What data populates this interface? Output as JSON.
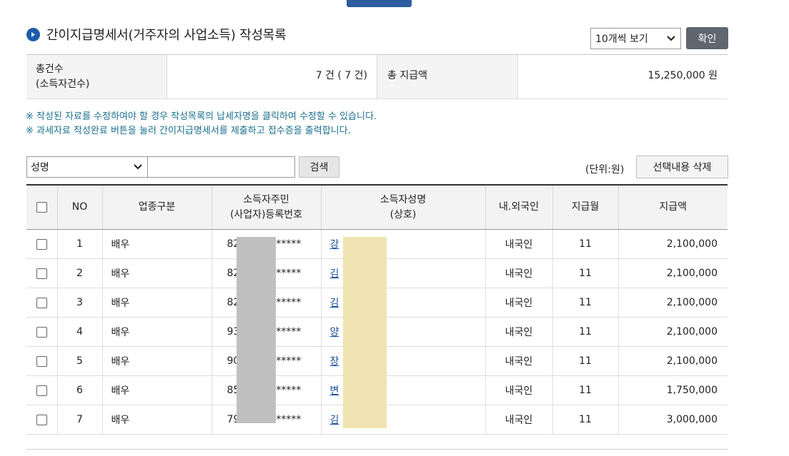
{
  "title": "간이지급명세서(거주자의 사업소득) 작성목록",
  "per_page": {
    "selected": "10개씩 보기"
  },
  "confirm_button": "확인",
  "summary": {
    "total_count_label_line1": "총건수",
    "total_count_label_line2": "(소득자건수)",
    "total_count_value": "7 건 ( 7 건)",
    "total_amount_label": "총 지급액",
    "total_amount_value": "15,250,000 원"
  },
  "notes": [
    "※ 작성된 자료를 수정하여야 할 경우 작성목록의 납세자명을 클릭하여 수정할 수 있습니다.",
    "※ 과세자료 작성완료 버튼을 눌러 간이지급명세서를 제출하고 접수증을 출력합니다."
  ],
  "search": {
    "field_selected": "성명",
    "input_value": "",
    "button": "검색"
  },
  "unit_label": "(단위:원)",
  "delete_button": "선택내용 삭제",
  "table": {
    "headers": {
      "no": "NO",
      "business_type": "업종구분",
      "reg_no_line1": "소득자주민",
      "reg_no_line2": "(사업자)등록번호",
      "name_line1": "소득자성명",
      "name_line2": "(상호)",
      "nationality": "내.외국인",
      "pay_month": "지급월",
      "amount": "지급액"
    },
    "rows": [
      {
        "no": "1",
        "business_type": "배우",
        "reg_prefix": "82",
        "reg_suffix": "******",
        "name": "강",
        "nationality": "내국인",
        "pay_month": "11",
        "amount": "2,100,000"
      },
      {
        "no": "2",
        "business_type": "배우",
        "reg_prefix": "82",
        "reg_suffix": "******",
        "name": "김",
        "nationality": "내국인",
        "pay_month": "11",
        "amount": "2,100,000"
      },
      {
        "no": "3",
        "business_type": "배우",
        "reg_prefix": "82",
        "reg_suffix": "******",
        "name": "김",
        "nationality": "내국인",
        "pay_month": "11",
        "amount": "2,100,000"
      },
      {
        "no": "4",
        "business_type": "배우",
        "reg_prefix": "93",
        "reg_suffix": "******",
        "name": "양",
        "nationality": "내국인",
        "pay_month": "11",
        "amount": "2,100,000"
      },
      {
        "no": "5",
        "business_type": "배우",
        "reg_prefix": "90",
        "reg_suffix": "******",
        "name": "장",
        "nationality": "내국인",
        "pay_month": "11",
        "amount": "2,100,000"
      },
      {
        "no": "6",
        "business_type": "배우",
        "reg_prefix": "85",
        "reg_suffix": "******",
        "name": "변",
        "nationality": "내국인",
        "pay_month": "11",
        "amount": "1,750,000"
      },
      {
        "no": "7",
        "business_type": "배우",
        "reg_prefix": "79",
        "reg_suffix": "******",
        "name": "김",
        "nationality": "내국인",
        "pay_month": "11",
        "amount": "3,000,000"
      }
    ]
  }
}
